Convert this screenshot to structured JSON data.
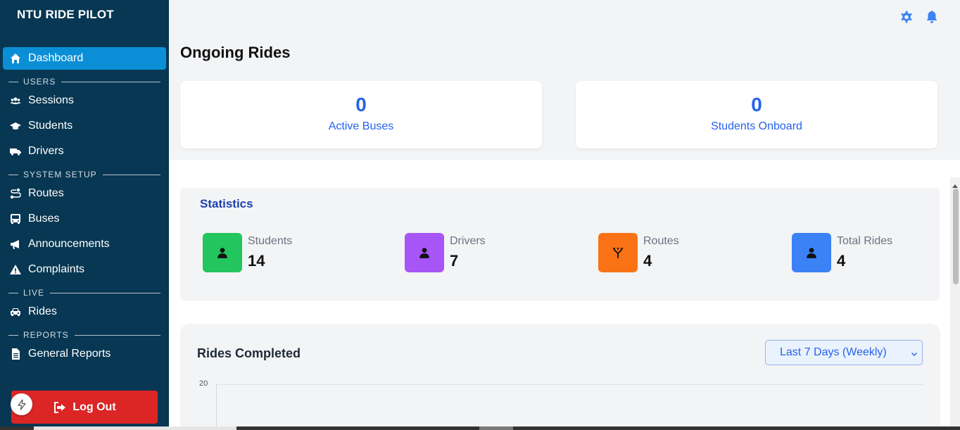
{
  "brand": "NTU RIDE PILOT",
  "sidebar": {
    "dashboard": "Dashboard",
    "sections": {
      "users": "USERS",
      "system_setup": "SYSTEM SETUP",
      "live": "LIVE",
      "reports": "REPORTS"
    },
    "items": {
      "sessions": "Sessions",
      "students": "Students",
      "drivers": "Drivers",
      "routes": "Routes",
      "buses": "Buses",
      "announcements": "Announcements",
      "complaints": "Complaints",
      "rides": "Rides",
      "general_reports": "General Reports"
    },
    "logout": "Log Out"
  },
  "header": {
    "icons": [
      "gear-icon",
      "bell-icon"
    ]
  },
  "page_title": "Ongoing Rides",
  "kpis": {
    "active_buses": {
      "value": "0",
      "label": "Active Buses"
    },
    "students_onboard": {
      "value": "0",
      "label": "Students Onboard"
    }
  },
  "statistics": {
    "title": "Statistics",
    "items": [
      {
        "label": "Students",
        "value": "14",
        "color": "#22c55e"
      },
      {
        "label": "Drivers",
        "value": "7",
        "color": "#a855f7"
      },
      {
        "label": "Routes",
        "value": "4",
        "color": "#f97316"
      },
      {
        "label": "Total Rides",
        "value": "4",
        "color": "#3b82f6"
      }
    ]
  },
  "rides_completed": {
    "title": "Rides Completed",
    "range": "Last 7 Days (Weekly)",
    "y_tick_top": "20"
  },
  "colors": {
    "sidebar": "#073752",
    "active": "#0a8fd6",
    "accent": "#2563eb",
    "logout": "#dc2626"
  }
}
